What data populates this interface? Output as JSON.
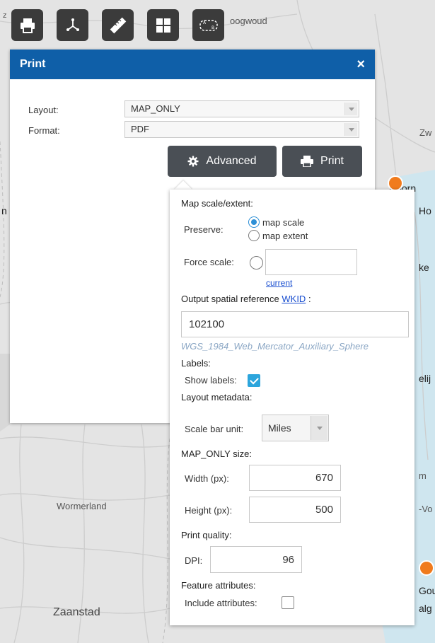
{
  "toolbar": {
    "tools": [
      {
        "name": "print-tool",
        "icon": "printer-icon"
      },
      {
        "name": "directions-tool",
        "icon": "route-icon"
      },
      {
        "name": "measure-tool",
        "icon": "ruler-icon"
      },
      {
        "name": "basemap-tool",
        "icon": "grid-icon"
      },
      {
        "name": "select-tool",
        "icon": "select-ab-icon"
      }
    ]
  },
  "map": {
    "labels": {
      "top": "oogwoud",
      "zw": "Zw",
      "hoorn_partial": "Hoorn",
      "ho": "Ho",
      "n": "n",
      "ke": "ke",
      "elij": "elij",
      "m": "m",
      "wormerland": "Wormerland",
      "vo": "-Vo",
      "zaanstad": "Zaanstad",
      "gou": "Gou",
      "alg": "alg",
      "z": "z"
    },
    "colors": {
      "background": "#e4e4e4",
      "water": "#cfe6ef",
      "marker": "#f07b1d"
    }
  },
  "print": {
    "title": "Print",
    "close": "×",
    "layout_label": "Layout:",
    "layout_value": "MAP_ONLY",
    "format_label": "Format:",
    "format_value": "PDF",
    "advanced_label": "Advanced",
    "print_label": "Print",
    "header_color": "#0f5fa8"
  },
  "advanced": {
    "map_scale_title": "Map scale/extent:",
    "preserve_label": "Preserve:",
    "preserve_options": [
      "map scale",
      "map extent"
    ],
    "preserve_selected": "map scale",
    "force_scale_label": "Force scale:",
    "force_scale_value": "",
    "current_link": "current",
    "sr_title": "Output spatial reference",
    "sr_link": "WKID",
    "sr_suffix": ":",
    "wkid_value": "102100",
    "wkid_name": "WGS_1984_Web_Mercator_Auxiliary_Sphere",
    "labels_title": "Labels:",
    "show_labels_label": "Show labels:",
    "show_labels_checked": true,
    "layout_metadata_title": "Layout metadata:",
    "scale_bar_unit_label": "Scale bar unit:",
    "scale_bar_unit_value": "Miles",
    "size_title": "MAP_ONLY size:",
    "width_label": "Width (px):",
    "width_value": "670",
    "height_label": "Height (px):",
    "height_value": "500",
    "quality_title": "Print quality:",
    "dpi_label": "DPI:",
    "dpi_value": "96",
    "feature_attr_title": "Feature attributes:",
    "include_attr_label": "Include attributes:",
    "include_attr_checked": false
  }
}
